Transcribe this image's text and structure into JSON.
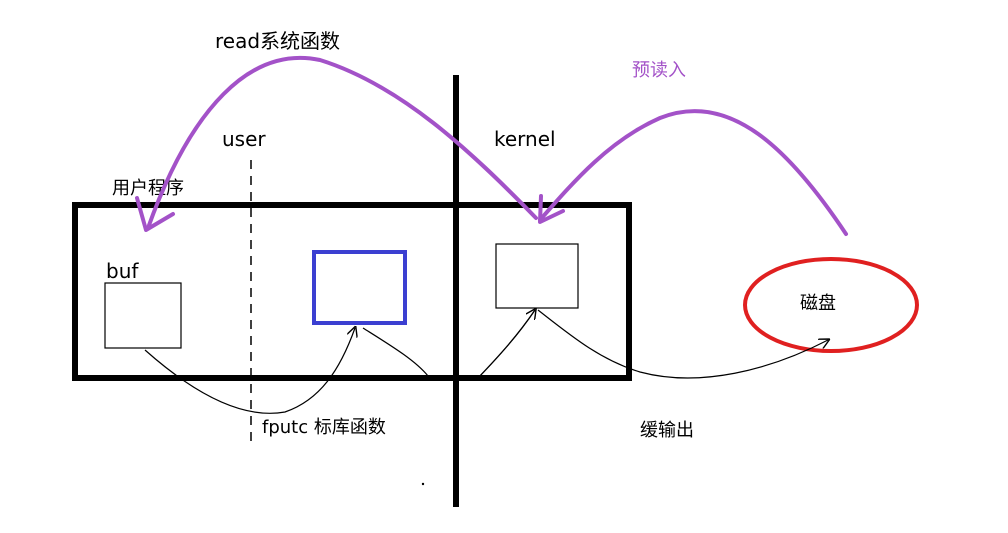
{
  "labels": {
    "read_syscall": "read系统函数",
    "preread": "预读入",
    "user": "user",
    "kernel": "kernel",
    "user_program": "用户程序",
    "buf": "buf",
    "disk": "磁盘",
    "fputc": "fputc 标库函数",
    "buffered_output": "缓输出"
  },
  "colors": {
    "purple_arrow": "#a352c8",
    "preread_text": "#a352c8",
    "user_buffer_border": "#3b3fd1",
    "disk_border": "#e02020",
    "outline": "#000000"
  }
}
